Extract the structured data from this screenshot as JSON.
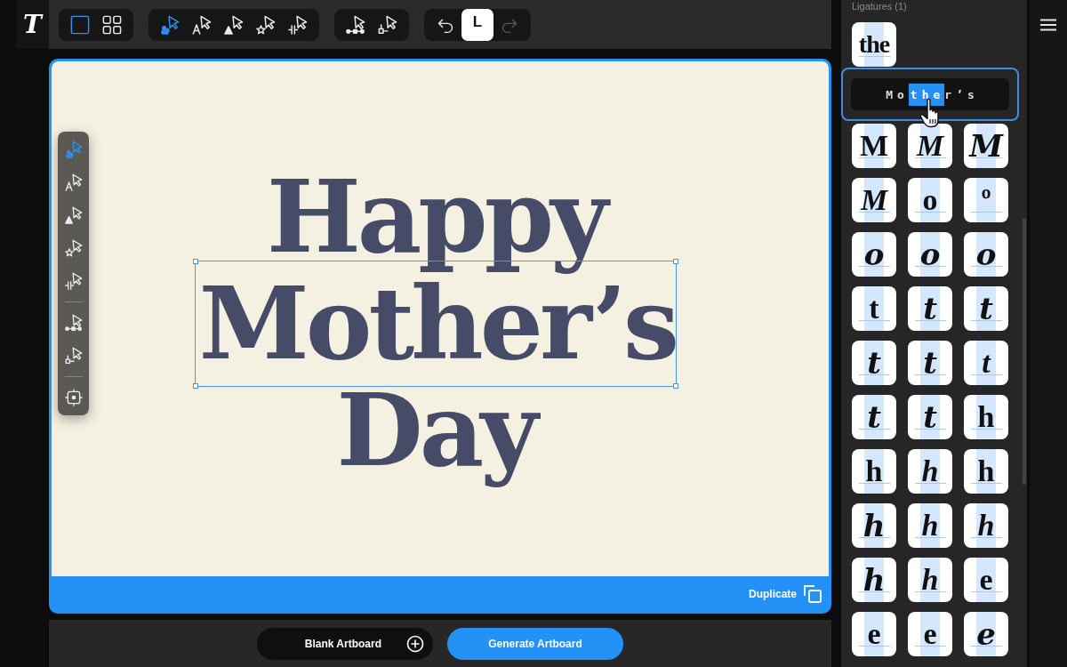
{
  "app_logo": "T",
  "toolbar": {
    "groups": [
      {
        "tools": [
          {
            "kind": "artboard",
            "selected": true
          },
          {
            "kind": "grid",
            "selected": false
          }
        ]
      },
      {
        "tools": [
          {
            "kind": "pointer-dots",
            "selected": true
          },
          {
            "kind": "pointer-letter",
            "selected": false
          },
          {
            "kind": "pointer-triangle",
            "selected": false
          },
          {
            "kind": "pointer-star",
            "selected": false
          },
          {
            "kind": "pointer-bars",
            "selected": false
          }
        ]
      },
      {
        "tools": [
          {
            "kind": "pointer-nodes",
            "selected": false
          },
          {
            "kind": "pointer-square",
            "selected": false
          }
        ]
      }
    ],
    "actions": [
      {
        "kind": "undo",
        "disabled": false
      },
      {
        "kind": "label",
        "text": "L"
      },
      {
        "kind": "redo",
        "disabled": true
      }
    ]
  },
  "floating_toolbar": {
    "groups": [
      {
        "tools": [
          {
            "kind": "pointer-dots",
            "selected": true
          },
          {
            "kind": "pointer-letter",
            "selected": false
          },
          {
            "kind": "pointer-triangle",
            "selected": false
          },
          {
            "kind": "pointer-star",
            "selected": false
          },
          {
            "kind": "pointer-bars",
            "selected": false
          }
        ]
      },
      {
        "tools": [
          {
            "kind": "pointer-nodes",
            "selected": false
          },
          {
            "kind": "pointer-square",
            "selected": false
          }
        ]
      },
      {
        "tools": [
          {
            "kind": "frame",
            "selected": false
          }
        ]
      }
    ]
  },
  "artboard": {
    "lines": [
      {
        "text": "Happy",
        "selected": false
      },
      {
        "text": "Mother’s",
        "selected": true
      },
      {
        "text": "Day",
        "selected": false
      }
    ],
    "action": "Duplicate"
  },
  "bottom_bar": {
    "buttons": [
      {
        "kind": "secondary",
        "label": "Blank Artboard"
      },
      {
        "kind": "primary",
        "label": "Generate Artboard"
      }
    ]
  },
  "glyph_panel": {
    "heading": "Ligatures (1)",
    "ligatures": [
      {
        "glyph": "the",
        "kind": "plain"
      }
    ],
    "popup": {
      "before": "Mo",
      "highlight": "the",
      "after": "r’s"
    },
    "alternates": [
      {
        "glyph": "M",
        "kind": "plain"
      },
      {
        "glyph": "M",
        "kind": "script"
      },
      {
        "glyph": "M",
        "kind": "swash"
      },
      {
        "glyph": "M",
        "kind": "script"
      },
      {
        "glyph": "o",
        "kind": "plain"
      },
      {
        "glyph": "º",
        "kind": "plain"
      },
      {
        "glyph": "o",
        "kind": "swash"
      },
      {
        "glyph": "o",
        "kind": "swash"
      },
      {
        "glyph": "o",
        "kind": "swash"
      },
      {
        "glyph": "t",
        "kind": "plain"
      },
      {
        "glyph": "t",
        "kind": "swash"
      },
      {
        "glyph": "t",
        "kind": "swash"
      },
      {
        "glyph": "t",
        "kind": "swash"
      },
      {
        "glyph": "t",
        "kind": "swash"
      },
      {
        "glyph": "t",
        "kind": "script"
      },
      {
        "glyph": "t",
        "kind": "swash"
      },
      {
        "glyph": "t",
        "kind": "swash"
      },
      {
        "glyph": "h",
        "kind": "plain"
      },
      {
        "glyph": "h",
        "kind": "plain"
      },
      {
        "glyph": "h",
        "kind": "script"
      },
      {
        "glyph": "h",
        "kind": "plain"
      },
      {
        "glyph": "h",
        "kind": "swash"
      },
      {
        "glyph": "h",
        "kind": "script"
      },
      {
        "glyph": "h",
        "kind": "script"
      },
      {
        "glyph": "h",
        "kind": "swash"
      },
      {
        "glyph": "h",
        "kind": "script"
      },
      {
        "glyph": "e",
        "kind": "plain"
      },
      {
        "glyph": "e",
        "kind": "plain"
      },
      {
        "glyph": "e",
        "kind": "plain"
      },
      {
        "glyph": "e",
        "kind": "swash"
      }
    ]
  }
}
